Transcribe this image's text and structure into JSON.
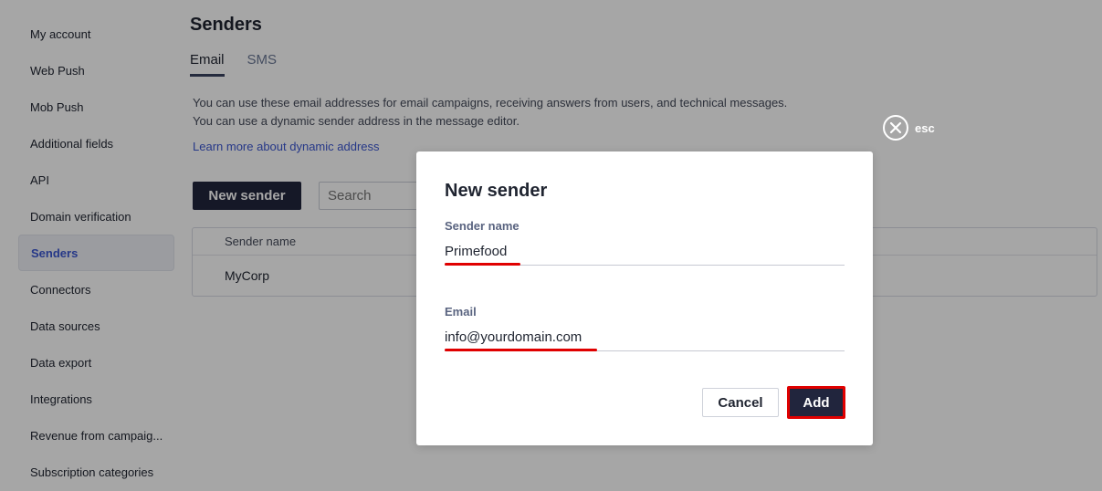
{
  "sidebar": {
    "items": [
      {
        "label": "My account",
        "active": false
      },
      {
        "label": "Web Push",
        "active": false
      },
      {
        "label": "Mob Push",
        "active": false
      },
      {
        "label": "Additional fields",
        "active": false
      },
      {
        "label": "API",
        "active": false
      },
      {
        "label": "Domain verification",
        "active": false
      },
      {
        "label": "Senders",
        "active": true
      },
      {
        "label": "Connectors",
        "active": false
      },
      {
        "label": "Data sources",
        "active": false
      },
      {
        "label": "Data export",
        "active": false
      },
      {
        "label": "Integrations",
        "active": false
      },
      {
        "label": "Revenue from campaig...",
        "active": false
      },
      {
        "label": "Subscription categories",
        "active": false
      }
    ]
  },
  "page": {
    "title": "Senders",
    "tabs": [
      {
        "label": "Email",
        "active": true
      },
      {
        "label": "SMS",
        "active": false
      }
    ],
    "info_line1": "You can use these email addresses for email campaigns, receiving answers from users, and technical messages.",
    "info_line2": "You can use a dynamic sender address in the message editor.",
    "learn_more": "Learn more about dynamic address",
    "new_sender_label": "New sender",
    "search_placeholder": "Search",
    "table": {
      "header": "Sender name",
      "rows": [
        "MyCorp"
      ]
    }
  },
  "close": {
    "icon": "close-icon",
    "label": "esc"
  },
  "modal": {
    "title": "New sender",
    "sender_name_label": "Sender name",
    "sender_name_value": "Primefood",
    "email_label": "Email",
    "email_value": "info@yourdomain.com",
    "cancel_label": "Cancel",
    "add_label": "Add"
  },
  "colors": {
    "accent_dark": "#21253d",
    "highlight_red": "#e00000",
    "link_blue": "#3b56d1"
  }
}
